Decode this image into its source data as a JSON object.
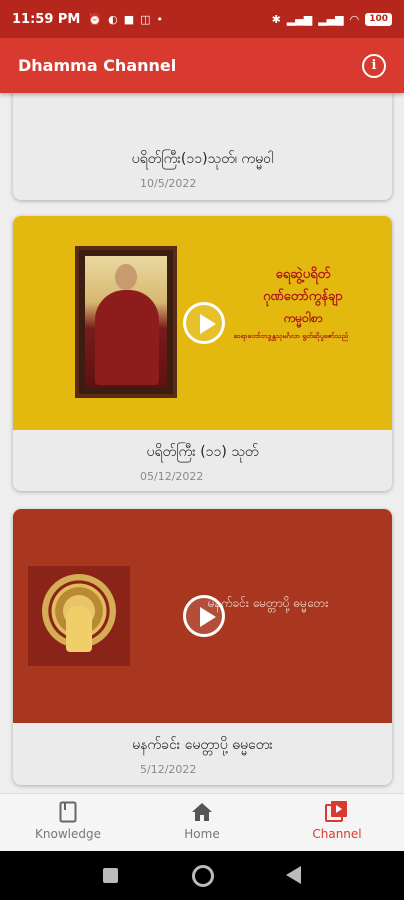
{
  "status_bar": {
    "time": "11:59 PM",
    "left_icons": [
      "alarm-icon",
      "circle-icon",
      "square-icon",
      "chat-icon",
      "dot-icon"
    ],
    "right_icons": [
      "bluetooth-icon",
      "signal-icon",
      "signal-icon",
      "wifi-icon"
    ],
    "battery": "100"
  },
  "app_bar": {
    "title": "Dhamma Channel",
    "info_icon": "info-icon"
  },
  "videos": [
    {
      "caption": "ပရိတ်ကြီး(၁၁)သုတ်၊ ကမ္မဝါ",
      "date": "10/5/2022"
    },
    {
      "caption": "ပရိတ်ကြီး (၁၁) သုတ်",
      "date": "05/12/2022",
      "thumb_lines": [
        "ရေဆွဲ့ပရိတ်",
        "ဂုဏ်တော်ကွန်ချာ",
        "ကမ္မဝါစာ",
        "ဆရာတော်ဘဒ္ဒန္တသုမင်္ဂလာ ရွတ်ဆိုပူဇော်သည်"
      ],
      "thumb_bg": "#e3b90f"
    },
    {
      "caption": "မနက်ခင်း မေတ္တာပို့ ဓမ္မတေး",
      "date": "5/12/2022",
      "thumb_line": "မနက်ခင်း မေတ္တာပို့ ဓမ္မတေး",
      "thumb_bg": "#a9361f"
    }
  ],
  "bottom_nav": [
    {
      "label": "Knowledge",
      "icon": "book-icon",
      "active": false
    },
    {
      "label": "Home",
      "icon": "home-icon",
      "active": false
    },
    {
      "label": "Channel",
      "icon": "video-library-icon",
      "active": true
    }
  ],
  "colors": {
    "status_bar": "#b5271c",
    "app_bar": "#d93a30",
    "accent": "#d93a30"
  }
}
